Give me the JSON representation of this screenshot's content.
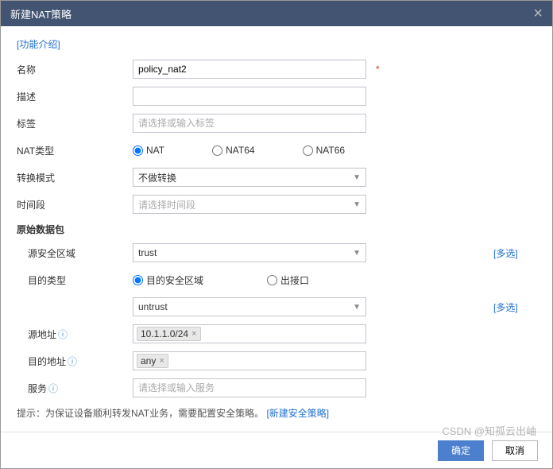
{
  "titlebar": {
    "title": "新建NAT策略"
  },
  "intro_link": "[功能介绍]",
  "fields": {
    "name": {
      "label": "名称",
      "value": "policy_nat2"
    },
    "desc": {
      "label": "描述",
      "value": ""
    },
    "tag": {
      "label": "标签",
      "placeholder": "请选择或输入标签"
    },
    "nat_type": {
      "label": "NAT类型",
      "options": [
        "NAT",
        "NAT64",
        "NAT66"
      ],
      "selected": "NAT"
    },
    "convert_mode": {
      "label": "转换模式",
      "value": "不做转换"
    },
    "time_range": {
      "label": "时间段",
      "placeholder": "请选择时间段"
    }
  },
  "packet": {
    "section_title": "原始数据包",
    "src_zone": {
      "label": "源安全区域",
      "value": "trust"
    },
    "dst_type": {
      "label": "目的类型",
      "options": [
        "目的安全区域",
        "出接口"
      ],
      "selected": "目的安全区域",
      "value": "untrust"
    },
    "src_addr": {
      "label": "源地址",
      "chips": [
        "10.1.1.0/24"
      ]
    },
    "dst_addr": {
      "label": "目的地址",
      "chips": [
        "any"
      ]
    },
    "service": {
      "label": "服务",
      "placeholder": "请选择或输入服务"
    },
    "multi_link": "[多选]"
  },
  "tip": {
    "prefix": "提示：为保证设备顺利转发NAT业务，需要配置安全策略。",
    "link": "[新建安全策略]"
  },
  "footer": {
    "ok": "确定",
    "cancel": "取消"
  },
  "watermark": "CSDN @知孤云出岫"
}
